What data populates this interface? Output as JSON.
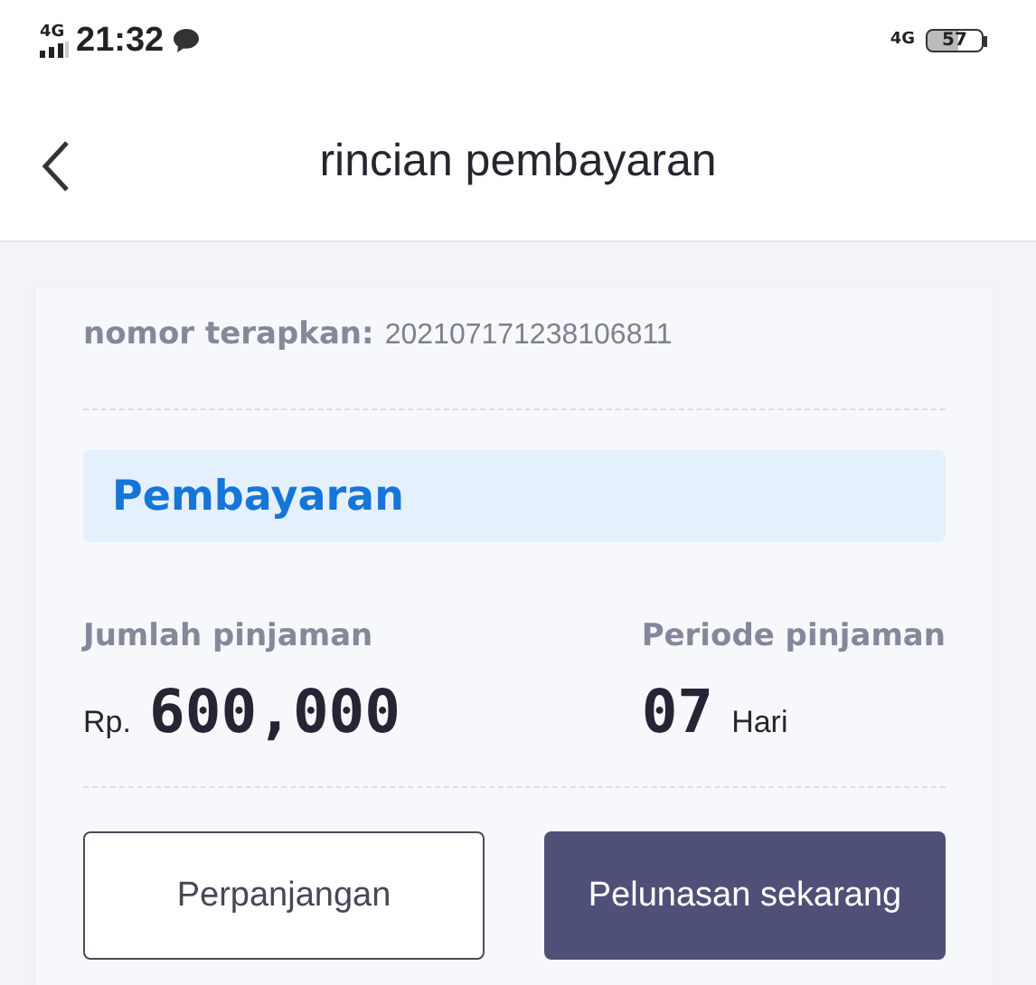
{
  "status_bar": {
    "network_left": "4G",
    "time": "21:32",
    "network_right": "4G",
    "battery": "57"
  },
  "header": {
    "title": "rincian pembayaran"
  },
  "card": {
    "application_label": "nomor terapkan:",
    "application_number": "202107171238106811",
    "section_title": "Pembayaran",
    "amount": {
      "label": "Jumlah pinjaman",
      "currency": "Rp.",
      "value": "600,000"
    },
    "period": {
      "label": "Periode pinjaman",
      "value": "07",
      "unit": "Hari"
    },
    "buttons": [
      {
        "label": "Perpanjangan",
        "kind": "outline"
      },
      {
        "label": "Pelunasan sekarang",
        "kind": "filled"
      }
    ]
  }
}
